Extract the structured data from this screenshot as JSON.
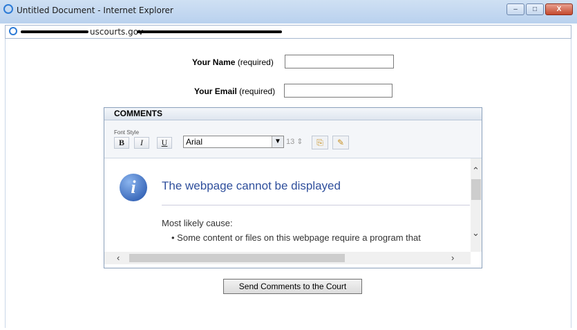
{
  "window": {
    "title": "Untitled Document - Internet Explorer",
    "controls": {
      "minimize": "–",
      "maximize": "□",
      "close": "X"
    }
  },
  "address_bar": {
    "url_visible_part": "uscourts.gov"
  },
  "form": {
    "name_label": "Your Name",
    "name_hint": "(required)",
    "name_value": "",
    "email_label": "Your Email",
    "email_hint": "(required)",
    "email_value": "",
    "comments_header": "COMMENTS",
    "toolbar": {
      "font_style_label": "Font Style",
      "bold": "B",
      "italic": "I",
      "underline": "U",
      "font_family": "Arial",
      "font_size": "13"
    },
    "editor_content": {
      "error_title": "The webpage cannot be displayed",
      "cause_heading": "Most likely cause:",
      "cause_item": "Some content or files on this webpage require a program that"
    },
    "submit_label": "Send Comments to the Court"
  },
  "colors": {
    "titlebar": "#b9d1ee",
    "error_title": "#2f4f9c",
    "close_button": "#c44a2e"
  }
}
